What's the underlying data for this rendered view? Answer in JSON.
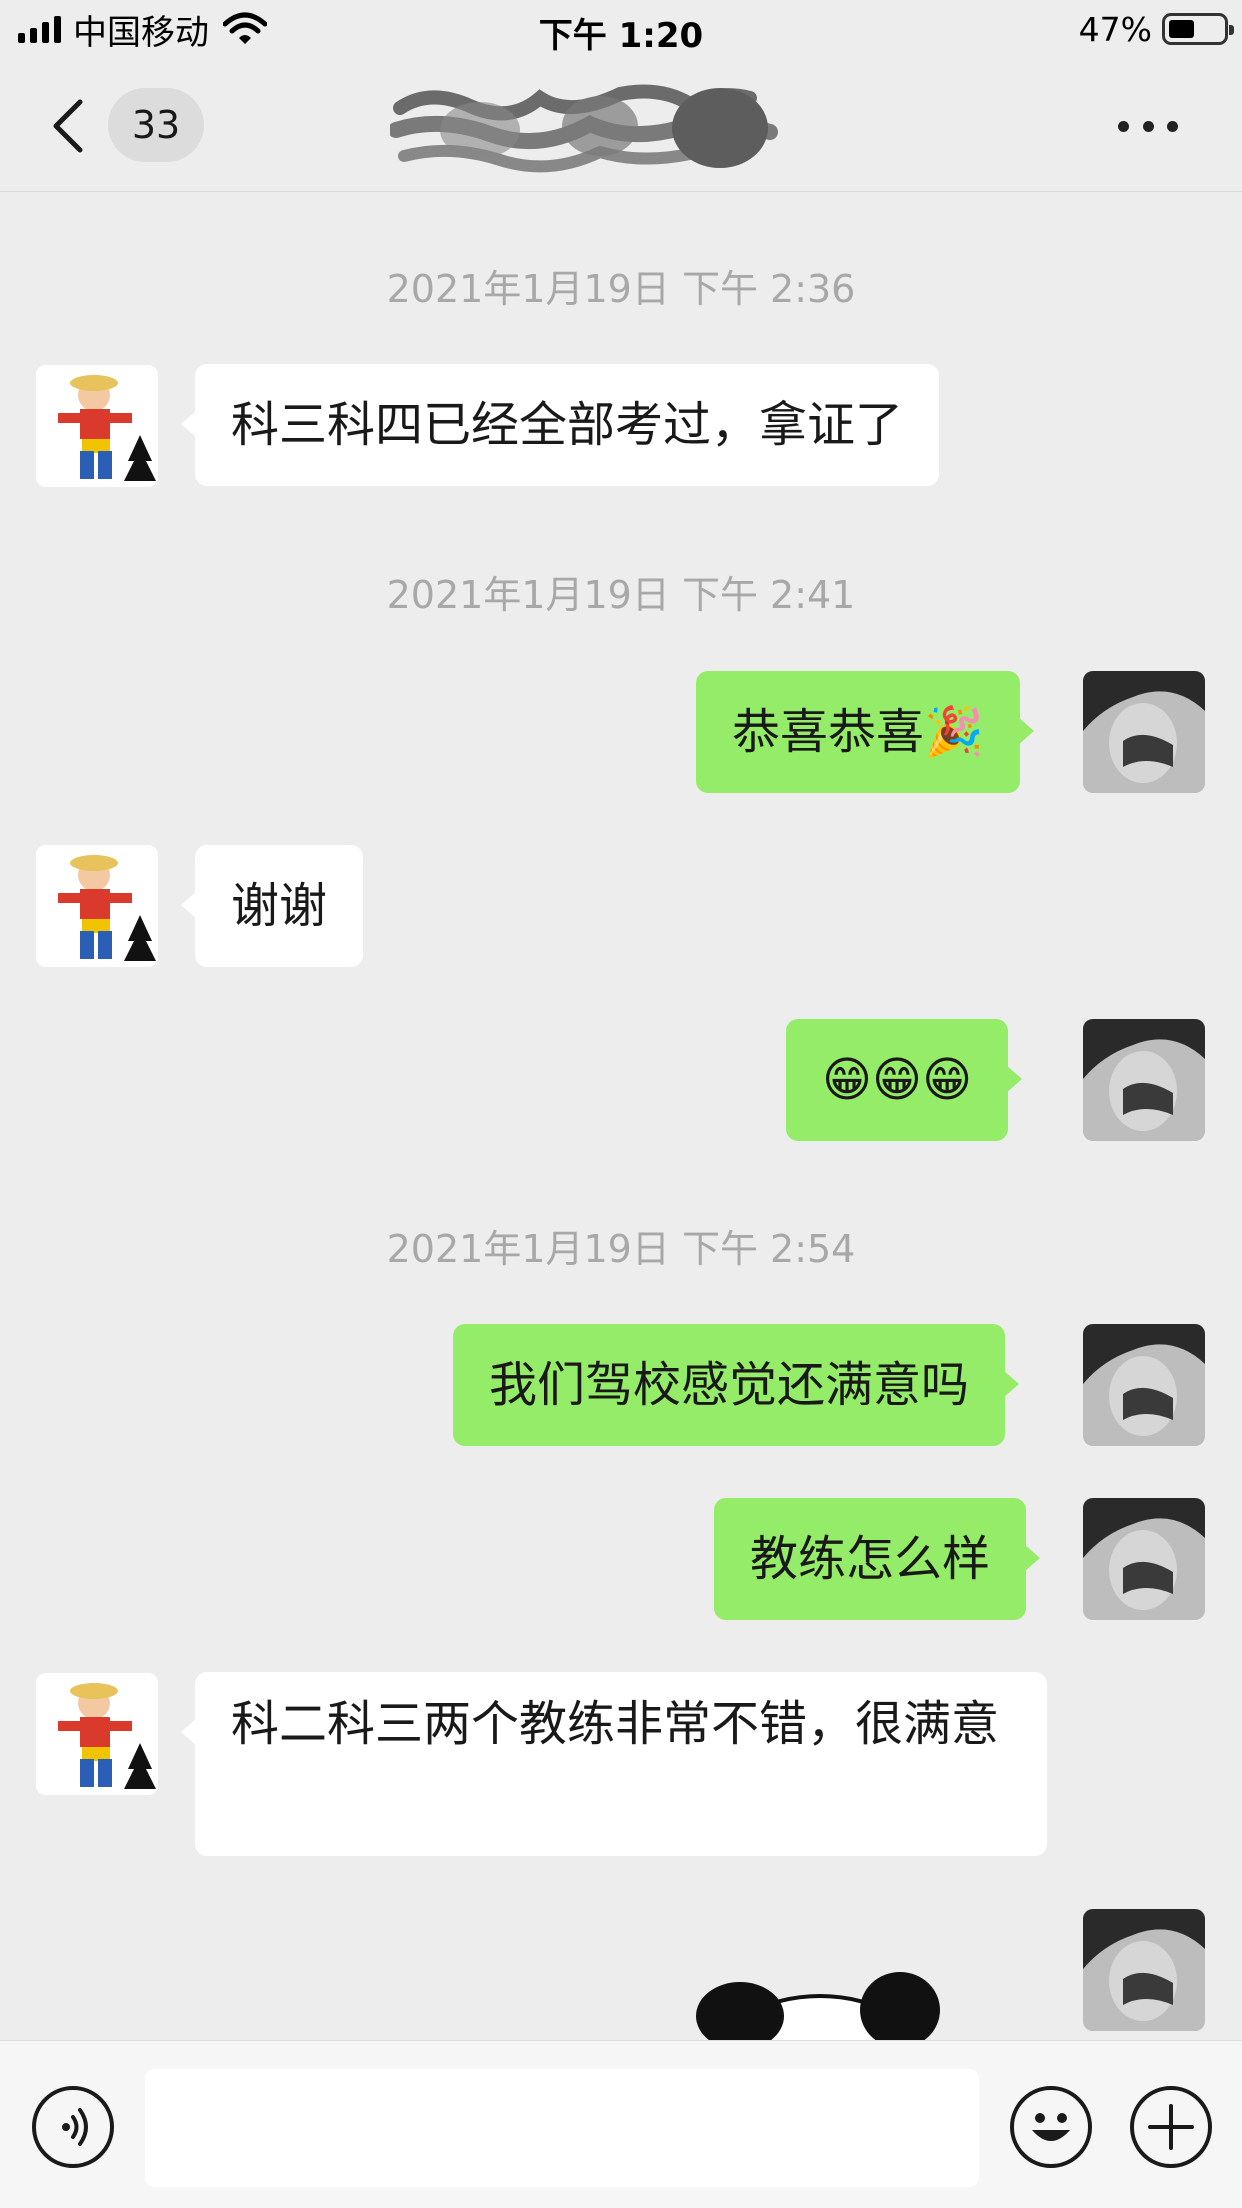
{
  "status_bar": {
    "carrier": "中国移动",
    "time": "下午 1:20",
    "battery_percent": "47%",
    "battery_level": 0.47
  },
  "nav": {
    "unread_count": "33",
    "back_icon": "chevron-left-icon",
    "more_icon": "ellipsis-icon"
  },
  "messages": [
    {
      "type": "time",
      "text": "2021年1月19日 下午 2:36"
    },
    {
      "type": "received",
      "text": "科三科四已经全部考过，拿证了"
    },
    {
      "type": "time",
      "text": "2021年1月19日 下午 2:41"
    },
    {
      "type": "sent",
      "text": "恭喜恭喜🎉"
    },
    {
      "type": "received",
      "text": "谢谢"
    },
    {
      "type": "sent",
      "text": "😁😁😁"
    },
    {
      "type": "time",
      "text": "2021年1月19日 下午 2:54"
    },
    {
      "type": "sent",
      "text": "我们驾校感觉还满意吗"
    },
    {
      "type": "sent",
      "text": "教练怎么样"
    },
    {
      "type": "received",
      "text": "科二科三两个教练非常不错，很满意"
    },
    {
      "type": "sent",
      "sticker": "panda-sticker"
    }
  ],
  "input_bar": {
    "voice_icon": "voice-icon",
    "emoji_icon": "emoji-icon",
    "plus_icon": "plus-icon",
    "input_value": ""
  },
  "colors": {
    "background": "#ededed",
    "sent_bubble": "#95ec69",
    "received_bubble": "#ffffff",
    "timestamp": "#a8a8a8"
  }
}
